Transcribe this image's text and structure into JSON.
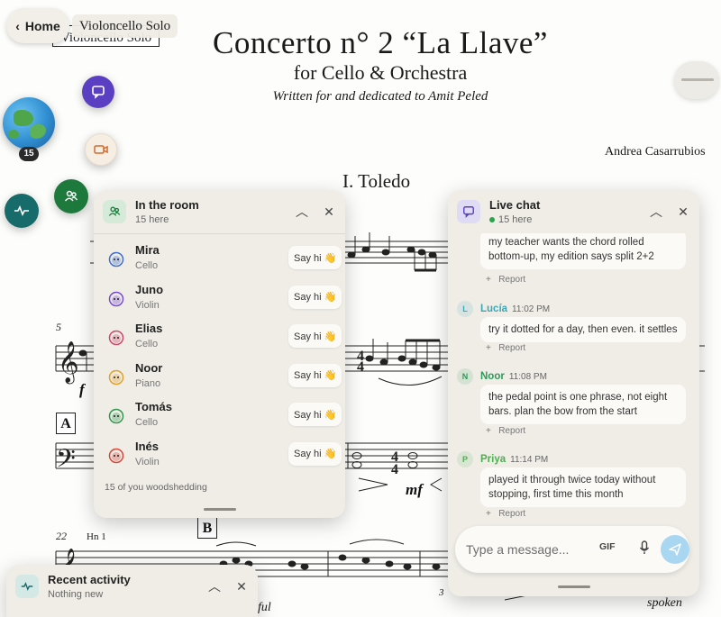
{
  "score": {
    "part_box": "Violoncello Solo",
    "title": "Concerto n° 2 “La Llave”",
    "subtitle": "for Cello & Orchestra",
    "dedication": "Written for and dedicated to Amit Peled",
    "composer": "Andrea Casarrubios",
    "movement": "I. Toledo",
    "measure_5": "5",
    "measure_22": "22",
    "rehearsal_a": "A",
    "rehearsal_b": "B",
    "dyn_f": "f",
    "dyn_mf": "mf",
    "horn_cue": "Hn 1",
    "tuplet_3": "3",
    "spoken": "spoken",
    "fragment_ful": "ful"
  },
  "nav": {
    "home_label": "Home",
    "piece_label": "Violoncello Solo"
  },
  "globe": {
    "badge": "15"
  },
  "room": {
    "title": "In the room",
    "subtitle": "15 here",
    "members": [
      {
        "name": "Mira",
        "instrument": "Cello",
        "color": "#3f6fd0",
        "say_hi": "Say hi 👋"
      },
      {
        "name": "Juno",
        "instrument": "Violin",
        "color": "#7a4ad8",
        "say_hi": "Say hi 👋"
      },
      {
        "name": "Elias",
        "instrument": "Cello",
        "color": "#d0486a",
        "say_hi": "Say hi 👋"
      },
      {
        "name": "Noor",
        "instrument": "Piano",
        "color": "#e3a12b",
        "say_hi": "Say hi 👋"
      },
      {
        "name": "Tomás",
        "instrument": "Cello",
        "color": "#2f9a4e",
        "say_hi": "Say hi 👋"
      },
      {
        "name": "Inés",
        "instrument": "Violin",
        "color": "#d9493a",
        "say_hi": "Say hi 👋"
      }
    ],
    "footer": "15 of you woodshedding"
  },
  "chat": {
    "title": "Live chat",
    "subtitle": "15 here",
    "first_message": "my teacher wants the chord rolled bottom-up, my edition says split 2+2",
    "first_report": "Report",
    "messages": [
      {
        "initial": "L",
        "author": "Lucía",
        "time": "11:02 PM",
        "text": "try it dotted for a day, then even. it settles",
        "report": "Report",
        "color": "#3aa7b8"
      },
      {
        "initial": "N",
        "author": "Noor",
        "time": "11:08 PM",
        "text": "the pedal point is one phrase, not eight bars. plan the bow from the start",
        "report": "Report",
        "color": "#2f9a5a"
      },
      {
        "initial": "P",
        "author": "Priya",
        "time": "11:14 PM",
        "text": "played it through twice today without stopping, first time this month",
        "report": "Report",
        "color": "#4caf50"
      }
    ],
    "input_placeholder": "Type a message...",
    "gif_label": "GIF"
  },
  "activity": {
    "title": "Recent activity",
    "subtitle": "Nothing new"
  },
  "colors": {
    "chat_fab": "#5a3fc2",
    "room_fab": "#1e7a3c",
    "activity_fab": "#176b6a",
    "send_button": "#a9d7f1"
  }
}
